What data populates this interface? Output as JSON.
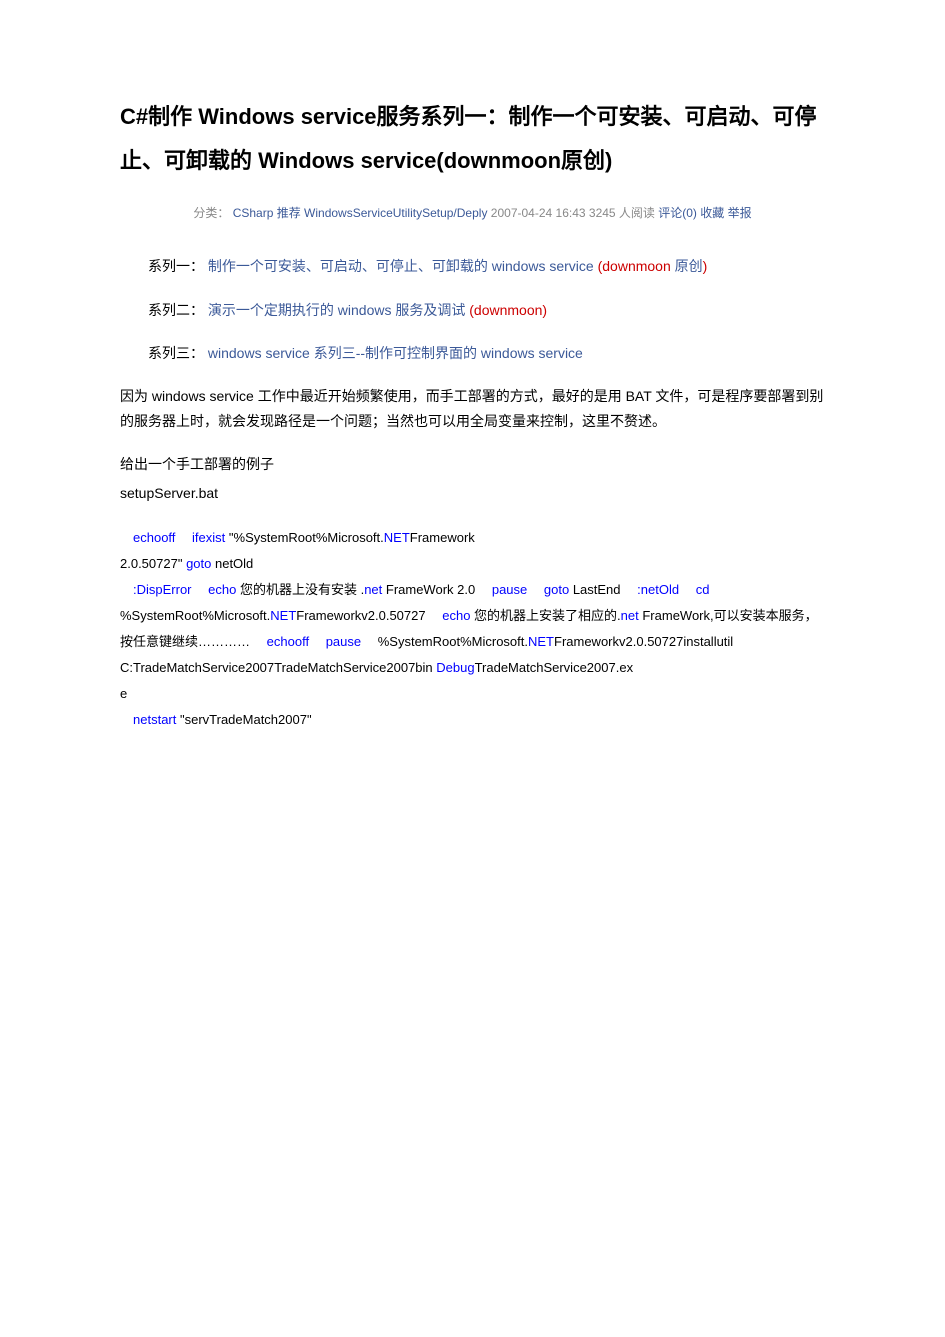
{
  "title": "C#制作 Windows service服务系列一：制作一个可安装、可启动、可停止、可卸载的 Windows service(downmoon原创)",
  "meta": {
    "cat_label": "分类：",
    "cat_link": "CSharp 推荐 WindowsServiceUtilitySetup/Deply",
    "date": "2007-04-24 16:43",
    "reads": "3245 人阅读",
    "comments": "评论(0)",
    "fav": "收藏",
    "report": "举报"
  },
  "series1": {
    "prefix": "系列一：",
    "link": "制作一个可安装、可启动、可停止、可卸载的 windows service",
    "open": "(",
    "dm": "downmoon",
    "orig": " 原创",
    "close": ")"
  },
  "series2": {
    "prefix": "系列二：",
    "link": "演示一个定期执行的 windows 服务及调试",
    "open": "(",
    "dm": "downmoon",
    "close": ")"
  },
  "series3": {
    "prefix": "系列三：",
    "link": "windows service 系列三--制作可控制界面的 windows service"
  },
  "para1": "因为 windows service   工作中最近开始频繁使用，而手工部署的方式，最好的是用 BAT 文件，可是程序要部署到别的服务器上时，就会发现路径是一个问题；当然也可以用全局变量来控制，这里不赘述。",
  "para2": "给出一个手工部署的例子",
  "file": "setupServer.bat",
  "code": {
    "l1a": "echo",
    "l1b": "off",
    "l2a": "if",
    "l2b": "exist",
    "l2c": " \"%SystemRoot%Microsoft.",
    "l2d": "NET",
    "l2e": "Framework",
    "l3a": "2.0.50727\" ",
    "l3b": "goto",
    "l3c": " netOld",
    "l4": ":DispError",
    "l5a": "echo",
    "l5b": " 您的机器上没有安装   .",
    "l5c": "net",
    "l5d": " FrameWork 2.0",
    "l6": "pause",
    "l7a": "goto",
    "l7b": " LastEnd",
    "l8": ":netOld",
    "l9a": "cd",
    "l9b": " %SystemRoot%Microsoft.",
    "l9c": "NET",
    "l9d": "Frameworkv2.0.50727",
    "l10a": "echo",
    "l10b": " 您的机器上安装了相应的.",
    "l10c": "net",
    "l10d": " FrameWork,可以安装本服务，按任意键继续…………",
    "l11a": "echo",
    "l11b": "off",
    "l12": "pause",
    "l13a": "%SystemRoot%Microsoft.",
    "l13b": "NET",
    "l13c": "Frameworkv2.0.50727installutil",
    "l14a": "C:TradeMatchService2007TradeMatchService2007bin ",
    "l14b": "Debug",
    "l14c": "TradeMatchService2007.ex",
    "l15": "e",
    "l16a": "net",
    "l16b": "start",
    "l16c": " \"servTradeMatch2007\""
  }
}
